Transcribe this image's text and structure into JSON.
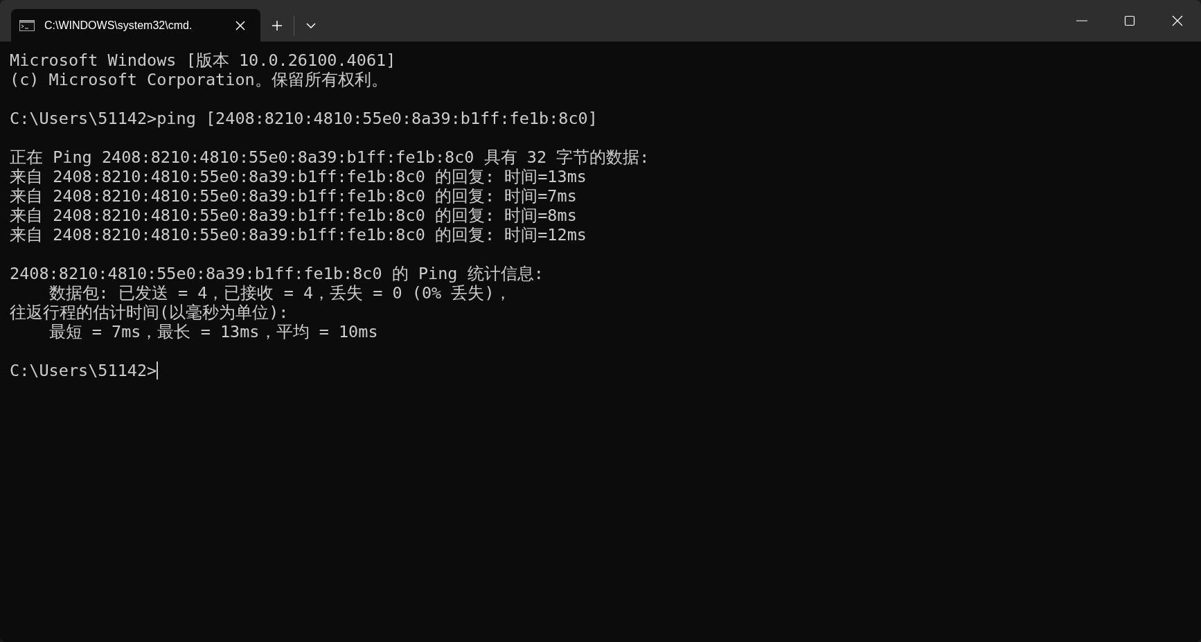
{
  "window": {
    "tab": {
      "title": "C:\\WINDOWS\\system32\\cmd.",
      "selected": true
    }
  },
  "console": {
    "blocks": [
      [
        "Microsoft Windows [版本 10.0.26100.4061]",
        "(c) Microsoft Corporation。保留所有权利。"
      ],
      [
        "C:\\Users\\51142>ping [2408:8210:4810:55e0:8a39:b1ff:fe1b:8c0]"
      ],
      [
        "正在 Ping 2408:8210:4810:55e0:8a39:b1ff:fe1b:8c0 具有 32 字节的数据:",
        "来自 2408:8210:4810:55e0:8a39:b1ff:fe1b:8c0 的回复: 时间=13ms",
        "来自 2408:8210:4810:55e0:8a39:b1ff:fe1b:8c0 的回复: 时间=7ms",
        "来自 2408:8210:4810:55e0:8a39:b1ff:fe1b:8c0 的回复: 时间=8ms",
        "来自 2408:8210:4810:55e0:8a39:b1ff:fe1b:8c0 的回复: 时间=12ms"
      ],
      [
        "2408:8210:4810:55e0:8a39:b1ff:fe1b:8c0 的 Ping 统计信息:",
        "    数据包: 已发送 = 4，已接收 = 4，丢失 = 0 (0% 丢失)，",
        "往返行程的估计时间(以毫秒为单位):",
        "    最短 = 7ms，最长 = 13ms，平均 = 10ms"
      ]
    ],
    "prompt": "C:\\Users\\51142>"
  }
}
